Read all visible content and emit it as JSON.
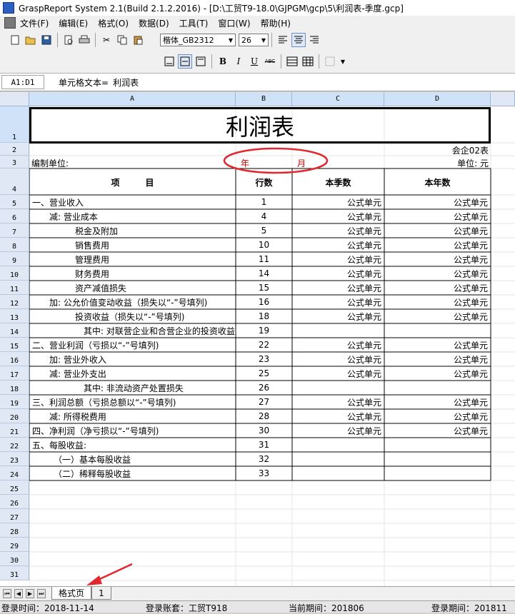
{
  "window": {
    "title": "GraspReport System 2.1(Build 2.1.2.2016) - [D:\\工贸T9-18.0\\GJPGM\\gcp\\5\\利润表-季度.gcp]"
  },
  "menu": [
    "文件(F)",
    "编辑(E)",
    "格式(O)",
    "数据(D)",
    "工具(T)",
    "窗口(W)",
    "帮助(H)"
  ],
  "toolbar": {
    "font_name": "楷体_GB2312",
    "font_size": "26",
    "bold": "B",
    "italic": "I",
    "underline": "U",
    "strike": "ABC"
  },
  "formula_bar": {
    "cell_ref": "A1:D1",
    "label": "单元格文本=",
    "value": "利润表"
  },
  "columns": [
    "A",
    "B",
    "C",
    "D"
  ],
  "row_numbers": [
    "1",
    "2",
    "3",
    "4",
    "5",
    "6",
    "7",
    "8",
    "9",
    "10",
    "11",
    "12",
    "13",
    "14",
    "15",
    "16",
    "17",
    "18",
    "19",
    "20",
    "21",
    "22",
    "23",
    "24",
    "25",
    "26",
    "27",
    "28",
    "29",
    "30",
    "31"
  ],
  "report": {
    "title": "利润表",
    "form_code": "会企02表",
    "unit_label": "编制单位:",
    "year_label": "年",
    "month_label": "月",
    "currency_unit": "单位: 元",
    "headers": {
      "item": "项　　　目",
      "line": "行数",
      "quarter": "本季数",
      "year": "本年数"
    },
    "rows": [
      {
        "item": "一、营业收入",
        "line": "1",
        "q": "公式单元",
        "y": "公式单元"
      },
      {
        "item": "　　减: 营业成本",
        "line": "4",
        "q": "公式单元",
        "y": "公式单元"
      },
      {
        "item": "　　　　　税金及附加",
        "line": "5",
        "q": "公式单元",
        "y": "公式单元"
      },
      {
        "item": "　　　　　销售费用",
        "line": "10",
        "q": "公式单元",
        "y": "公式单元"
      },
      {
        "item": "　　　　　管理费用",
        "line": "11",
        "q": "公式单元",
        "y": "公式单元"
      },
      {
        "item": "　　　　　财务费用",
        "line": "14",
        "q": "公式单元",
        "y": "公式单元"
      },
      {
        "item": "　　　　　资产减值损失",
        "line": "15",
        "q": "公式单元",
        "y": "公式单元"
      },
      {
        "item": "　　加: 公允价值变动收益（损失以“-”号填列)",
        "line": "16",
        "q": "公式单元",
        "y": "公式单元"
      },
      {
        "item": "　　　　　投资收益（损失以“-”号填列)",
        "line": "18",
        "q": "公式单元",
        "y": "公式单元"
      },
      {
        "item": "　　　　　　其中: 对联营企业和合营企业的投资收益",
        "line": "19",
        "q": "",
        "y": ""
      },
      {
        "item": "二、营业利润（亏损以“-”号填列)",
        "line": "22",
        "q": "公式单元",
        "y": "公式单元"
      },
      {
        "item": "　　加: 营业外收入",
        "line": "23",
        "q": "公式单元",
        "y": "公式单元"
      },
      {
        "item": "　　减: 营业外支出",
        "line": "25",
        "q": "公式单元",
        "y": "公式单元"
      },
      {
        "item": "　　　　　　其中: 非流动资产处置损失",
        "line": "26",
        "q": "",
        "y": ""
      },
      {
        "item": "三、利润总额（亏损总额以“-”号填列)",
        "line": "27",
        "q": "公式单元",
        "y": "公式单元"
      },
      {
        "item": "　　减: 所得税费用",
        "line": "28",
        "q": "公式单元",
        "y": "公式单元"
      },
      {
        "item": "四、净利润（净亏损以“-”号填列)",
        "line": "30",
        "q": "公式单元",
        "y": "公式单元"
      },
      {
        "item": "五、每股收益:",
        "line": "31",
        "q": "",
        "y": ""
      },
      {
        "item": "　　　（一）基本每股收益",
        "line": "32",
        "q": "",
        "y": ""
      },
      {
        "item": "　　　（二）稀释每股收益",
        "line": "33",
        "q": "",
        "y": ""
      }
    ]
  },
  "sheets": {
    "format_tab": "格式页",
    "page_tab": "1"
  },
  "status": {
    "login_time": "登录时间：2018-11-14",
    "account": "登录账套：工贸T918",
    "current_period": "当前期间：201806",
    "login_period": "登录期间：201811"
  },
  "colors": {
    "annotation_red": "#e0282e",
    "header_blue": "#cfe2f7",
    "red_text": "#c00000"
  }
}
